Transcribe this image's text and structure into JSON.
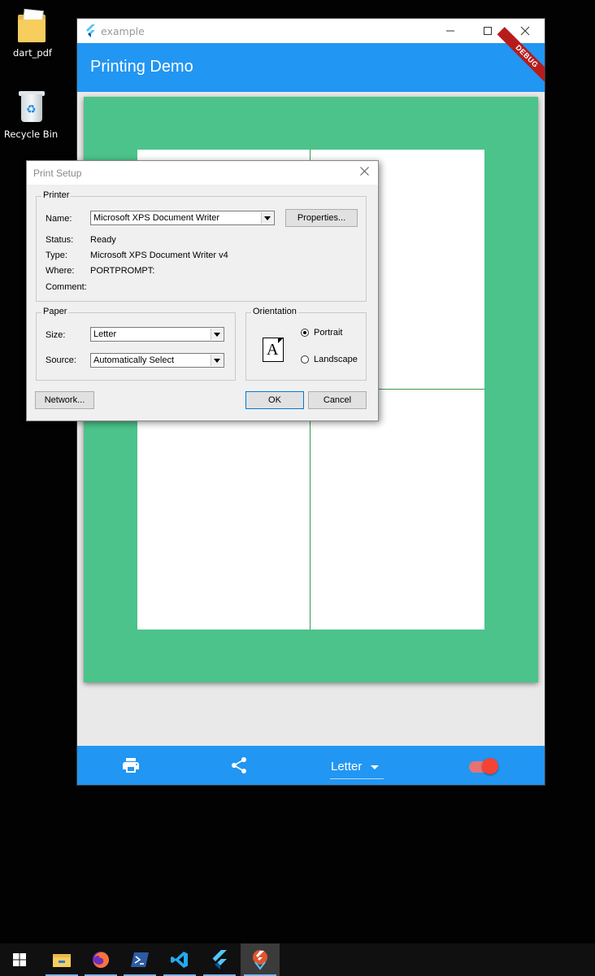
{
  "desktop": {
    "icons": [
      {
        "label": "dart_pdf",
        "icon": "folder-icon"
      },
      {
        "label": "Recycle Bin",
        "icon": "recycle-bin-icon"
      }
    ]
  },
  "window": {
    "title": "example",
    "app_title": "Printing Demo",
    "debug_banner": "DEBUG",
    "bottom_bar": {
      "print_icon": "print-icon",
      "share_icon": "share-icon",
      "page_format": "Letter",
      "toggle_on": true
    }
  },
  "dialog": {
    "title": "Print Setup",
    "printer": {
      "group_label": "Printer",
      "name_label": "Name:",
      "name_value": "Microsoft XPS Document Writer",
      "properties_button": "Properties...",
      "status_label": "Status:",
      "status_value": "Ready",
      "type_label": "Type:",
      "type_value": "Microsoft XPS Document Writer v4",
      "where_label": "Where:",
      "where_value": "PORTPROMPT:",
      "comment_label": "Comment:"
    },
    "paper": {
      "group_label": "Paper",
      "size_label": "Size:",
      "size_value": "Letter",
      "source_label": "Source:",
      "source_value": "Automatically Select"
    },
    "orientation": {
      "group_label": "Orientation",
      "portrait": "Portrait",
      "landscape": "Landscape",
      "selected": "Portrait",
      "icon_letter": "A"
    },
    "buttons": {
      "network": "Network...",
      "ok": "OK",
      "cancel": "Cancel"
    }
  },
  "taskbar": {
    "items": [
      "windows-start-icon",
      "file-explorer-icon",
      "firefox-icon",
      "powershell-icon",
      "vscode-icon",
      "flutter-icon",
      "flutter-devtools-icon"
    ],
    "active_index": 6
  },
  "colors": {
    "accent": "#2196f3",
    "page_green": "#4cc38a",
    "toggle_red": "#f44336"
  }
}
